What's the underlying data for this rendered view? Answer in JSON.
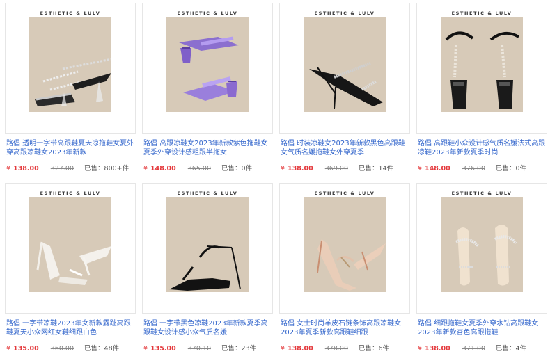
{
  "products": [
    {
      "brand": "ESTHETIC & LULV",
      "title": "路倡 透明一字带高跟鞋夏天凉拖鞋女夏外穿高跟凉鞋女2023年新款",
      "currency": "¥",
      "price": "138.00",
      "old_price": "327.00",
      "sold": "已售：800+件",
      "image_icon": "clear-strap-heel-sandal-image"
    },
    {
      "brand": "ESTHETIC & LULV",
      "title": "路倡 高跟凉鞋女2023年新款紫色拖鞋女夏季外穿设计感粗跟半拖女",
      "currency": "¥",
      "price": "148.00",
      "old_price": "365.00",
      "sold": "已售：0件",
      "image_icon": "purple-block-heel-slide-image"
    },
    {
      "brand": "ESTHETIC & LULV",
      "title": "路倡 时装凉鞋女2023年新款黑色高跟鞋女气质名媛拖鞋女外穿夏季",
      "currency": "¥",
      "price": "138.00",
      "old_price": "369.00",
      "sold": "已售：14件",
      "image_icon": "black-rhinestone-mule-image"
    },
    {
      "brand": "ESTHETIC & LULV",
      "title": "路倡 高跟鞋小众设计感气质名媛法式高跟凉鞋2023年新款夏季时尚",
      "currency": "¥",
      "price": "148.00",
      "old_price": "376.00",
      "sold": "已售：0件",
      "image_icon": "black-pearl-ankle-strap-heel-image"
    },
    {
      "brand": "ESTHETIC & LULV",
      "title": "路倡 一字带凉鞋2023年女新款露趾高跟鞋夏天小众网红女鞋细跟白色",
      "currency": "¥",
      "price": "135.00",
      "old_price": "360.00",
      "sold": "已售：48件",
      "image_icon": "white-strappy-heel-image"
    },
    {
      "brand": "ESTHETIC & LULV",
      "title": "路倡 一字带黑色凉鞋2023年新款夏季高跟鞋女设计感小众气质名媛",
      "currency": "¥",
      "price": "135.00",
      "old_price": "370.10",
      "sold": "已售：23件",
      "image_icon": "black-strappy-heel-image"
    },
    {
      "brand": "ESTHETIC & LULV",
      "title": "路倡 女士时尚羊皮石链条饰高跟凉鞋女2023年夏季新款高跟鞋细跟",
      "currency": "¥",
      "price": "138.00",
      "old_price": "378.00",
      "sold": "已售：6件",
      "image_icon": "nude-chain-heel-image"
    },
    {
      "brand": "ESTHETIC & LULV",
      "title": "路倡 细跟拖鞋女夏季外穿水钻高跟鞋女2023年新款杏色高跟拖鞋",
      "currency": "¥",
      "price": "138.00",
      "old_price": "371.00",
      "sold": "已售：4件",
      "image_icon": "beige-crystal-heel-mule-image"
    }
  ],
  "colors": {
    "link": "#3366cc",
    "price": "#e4393c",
    "photo_bg": "#d7cab8"
  }
}
